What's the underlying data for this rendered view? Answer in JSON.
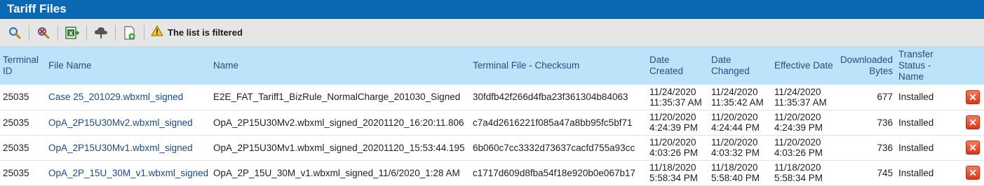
{
  "panel": {
    "title": "Tariff Files"
  },
  "toolbar": {
    "icons": [
      "search-icon",
      "clear-filter-icon",
      "export-excel-icon",
      "upload-icon",
      "add-file-icon"
    ],
    "filter_notice": "The list is filtered"
  },
  "table": {
    "headers": {
      "terminal_id": "Terminal ID",
      "file_name": "File Name",
      "name": "Name",
      "checksum": "Terminal File - Checksum",
      "date_created": "Date Created",
      "date_changed": "Date Changed",
      "effective_date": "Effective Date",
      "downloaded_bytes": "Downloaded Bytes",
      "transfer_status": "Transfer Status - Name"
    },
    "rows": [
      {
        "terminal_id": "25035",
        "file_name": "Case 25_201029.wbxml_signed",
        "name": "E2E_FAT_Tariff1_BizRule_NormalCharge_201030_Signed",
        "checksum": "30fdfb42f266d4fba23f361304b84063",
        "date_created": "11/24/2020 11:35:37 AM",
        "date_changed": "11/24/2020 11:35:42 AM",
        "effective_date": "11/24/2020 11:35:37 AM",
        "downloaded_bytes": "677",
        "transfer_status": "Installed"
      },
      {
        "terminal_id": "25035",
        "file_name": "OpA_2P15U30Mv2.wbxml_signed",
        "name": "OpA_2P15U30Mv2.wbxml_signed_20201120_16:20:11.806",
        "checksum": "c7a4d2616221f085a47a8bb95fc5bf71",
        "date_created": "11/20/2020 4:24:39 PM",
        "date_changed": "11/20/2020 4:24:44 PM",
        "effective_date": "11/20/2020 4:24:39 PM",
        "downloaded_bytes": "736",
        "transfer_status": "Installed"
      },
      {
        "terminal_id": "25035",
        "file_name": "OpA_2P15U30Mv1.wbxml_signed",
        "name": "OpA_2P15U30Mv1.wbxml_signed_20201120_15:53:44.195",
        "checksum": "6b060c7cc3332d73637cacfd755a93cc",
        "date_created": "11/20/2020 4:03:26 PM",
        "date_changed": "11/20/2020 4:03:32 PM",
        "effective_date": "11/20/2020 4:03:26 PM",
        "downloaded_bytes": "736",
        "transfer_status": "Installed"
      },
      {
        "terminal_id": "25035",
        "file_name": "OpA_2P_15U_30M_v1.wbxml_signed",
        "name": "OpA_2P_15U_30M_v1.wbxml_signed_11/6/2020_1:28 AM",
        "checksum": "c1717d609d8fba54f18e920b0e067b17",
        "date_created": "11/18/2020 5:58:34 PM",
        "date_changed": "11/18/2020 5:58:40 PM",
        "effective_date": "11/18/2020 5:58:34 PM",
        "downloaded_bytes": "745",
        "transfer_status": "Installed"
      }
    ],
    "delete_glyph": "✕"
  }
}
